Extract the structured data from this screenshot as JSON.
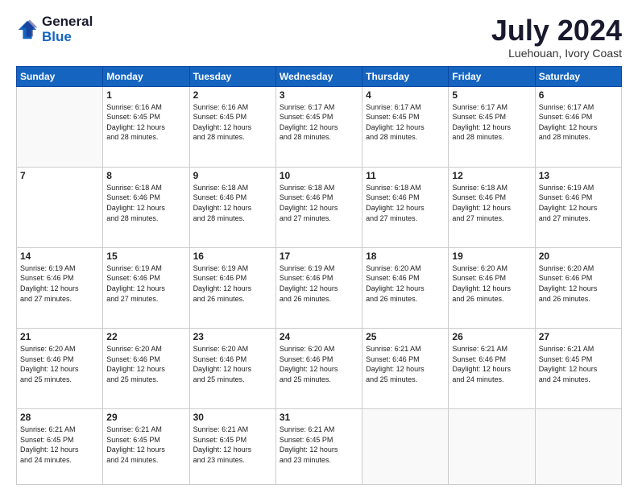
{
  "logo": {
    "general": "General",
    "blue": "Blue"
  },
  "title": "July 2024",
  "location": "Luehouan, Ivory Coast",
  "days_of_week": [
    "Sunday",
    "Monday",
    "Tuesday",
    "Wednesday",
    "Thursday",
    "Friday",
    "Saturday"
  ],
  "weeks": [
    [
      {
        "day": "",
        "info": ""
      },
      {
        "day": "1",
        "info": "Sunrise: 6:16 AM\nSunset: 6:45 PM\nDaylight: 12 hours\nand 28 minutes."
      },
      {
        "day": "2",
        "info": "Sunrise: 6:16 AM\nSunset: 6:45 PM\nDaylight: 12 hours\nand 28 minutes."
      },
      {
        "day": "3",
        "info": "Sunrise: 6:17 AM\nSunset: 6:45 PM\nDaylight: 12 hours\nand 28 minutes."
      },
      {
        "day": "4",
        "info": "Sunrise: 6:17 AM\nSunset: 6:45 PM\nDaylight: 12 hours\nand 28 minutes."
      },
      {
        "day": "5",
        "info": "Sunrise: 6:17 AM\nSunset: 6:45 PM\nDaylight: 12 hours\nand 28 minutes."
      },
      {
        "day": "6",
        "info": "Sunrise: 6:17 AM\nSunset: 6:46 PM\nDaylight: 12 hours\nand 28 minutes."
      }
    ],
    [
      {
        "day": "7",
        "info": ""
      },
      {
        "day": "8",
        "info": "Sunrise: 6:18 AM\nSunset: 6:46 PM\nDaylight: 12 hours\nand 28 minutes."
      },
      {
        "day": "9",
        "info": "Sunrise: 6:18 AM\nSunset: 6:46 PM\nDaylight: 12 hours\nand 28 minutes."
      },
      {
        "day": "10",
        "info": "Sunrise: 6:18 AM\nSunset: 6:46 PM\nDaylight: 12 hours\nand 27 minutes."
      },
      {
        "day": "11",
        "info": "Sunrise: 6:18 AM\nSunset: 6:46 PM\nDaylight: 12 hours\nand 27 minutes."
      },
      {
        "day": "12",
        "info": "Sunrise: 6:18 AM\nSunset: 6:46 PM\nDaylight: 12 hours\nand 27 minutes."
      },
      {
        "day": "13",
        "info": "Sunrise: 6:19 AM\nSunset: 6:46 PM\nDaylight: 12 hours\nand 27 minutes."
      }
    ],
    [
      {
        "day": "14",
        "info": "Sunrise: 6:19 AM\nSunset: 6:46 PM\nDaylight: 12 hours\nand 27 minutes."
      },
      {
        "day": "15",
        "info": "Sunrise: 6:19 AM\nSunset: 6:46 PM\nDaylight: 12 hours\nand 27 minutes."
      },
      {
        "day": "16",
        "info": "Sunrise: 6:19 AM\nSunset: 6:46 PM\nDaylight: 12 hours\nand 26 minutes."
      },
      {
        "day": "17",
        "info": "Sunrise: 6:19 AM\nSunset: 6:46 PM\nDaylight: 12 hours\nand 26 minutes."
      },
      {
        "day": "18",
        "info": "Sunrise: 6:20 AM\nSunset: 6:46 PM\nDaylight: 12 hours\nand 26 minutes."
      },
      {
        "day": "19",
        "info": "Sunrise: 6:20 AM\nSunset: 6:46 PM\nDaylight: 12 hours\nand 26 minutes."
      },
      {
        "day": "20",
        "info": "Sunrise: 6:20 AM\nSunset: 6:46 PM\nDaylight: 12 hours\nand 26 minutes."
      }
    ],
    [
      {
        "day": "21",
        "info": "Sunrise: 6:20 AM\nSunset: 6:46 PM\nDaylight: 12 hours\nand 25 minutes."
      },
      {
        "day": "22",
        "info": "Sunrise: 6:20 AM\nSunset: 6:46 PM\nDaylight: 12 hours\nand 25 minutes."
      },
      {
        "day": "23",
        "info": "Sunrise: 6:20 AM\nSunset: 6:46 PM\nDaylight: 12 hours\nand 25 minutes."
      },
      {
        "day": "24",
        "info": "Sunrise: 6:20 AM\nSunset: 6:46 PM\nDaylight: 12 hours\nand 25 minutes."
      },
      {
        "day": "25",
        "info": "Sunrise: 6:21 AM\nSunset: 6:46 PM\nDaylight: 12 hours\nand 25 minutes."
      },
      {
        "day": "26",
        "info": "Sunrise: 6:21 AM\nSunset: 6:46 PM\nDaylight: 12 hours\nand 24 minutes."
      },
      {
        "day": "27",
        "info": "Sunrise: 6:21 AM\nSunset: 6:45 PM\nDaylight: 12 hours\nand 24 minutes."
      }
    ],
    [
      {
        "day": "28",
        "info": "Sunrise: 6:21 AM\nSunset: 6:45 PM\nDaylight: 12 hours\nand 24 minutes."
      },
      {
        "day": "29",
        "info": "Sunrise: 6:21 AM\nSunset: 6:45 PM\nDaylight: 12 hours\nand 24 minutes."
      },
      {
        "day": "30",
        "info": "Sunrise: 6:21 AM\nSunset: 6:45 PM\nDaylight: 12 hours\nand 23 minutes."
      },
      {
        "day": "31",
        "info": "Sunrise: 6:21 AM\nSunset: 6:45 PM\nDaylight: 12 hours\nand 23 minutes."
      },
      {
        "day": "",
        "info": ""
      },
      {
        "day": "",
        "info": ""
      },
      {
        "day": "",
        "info": ""
      }
    ]
  ]
}
